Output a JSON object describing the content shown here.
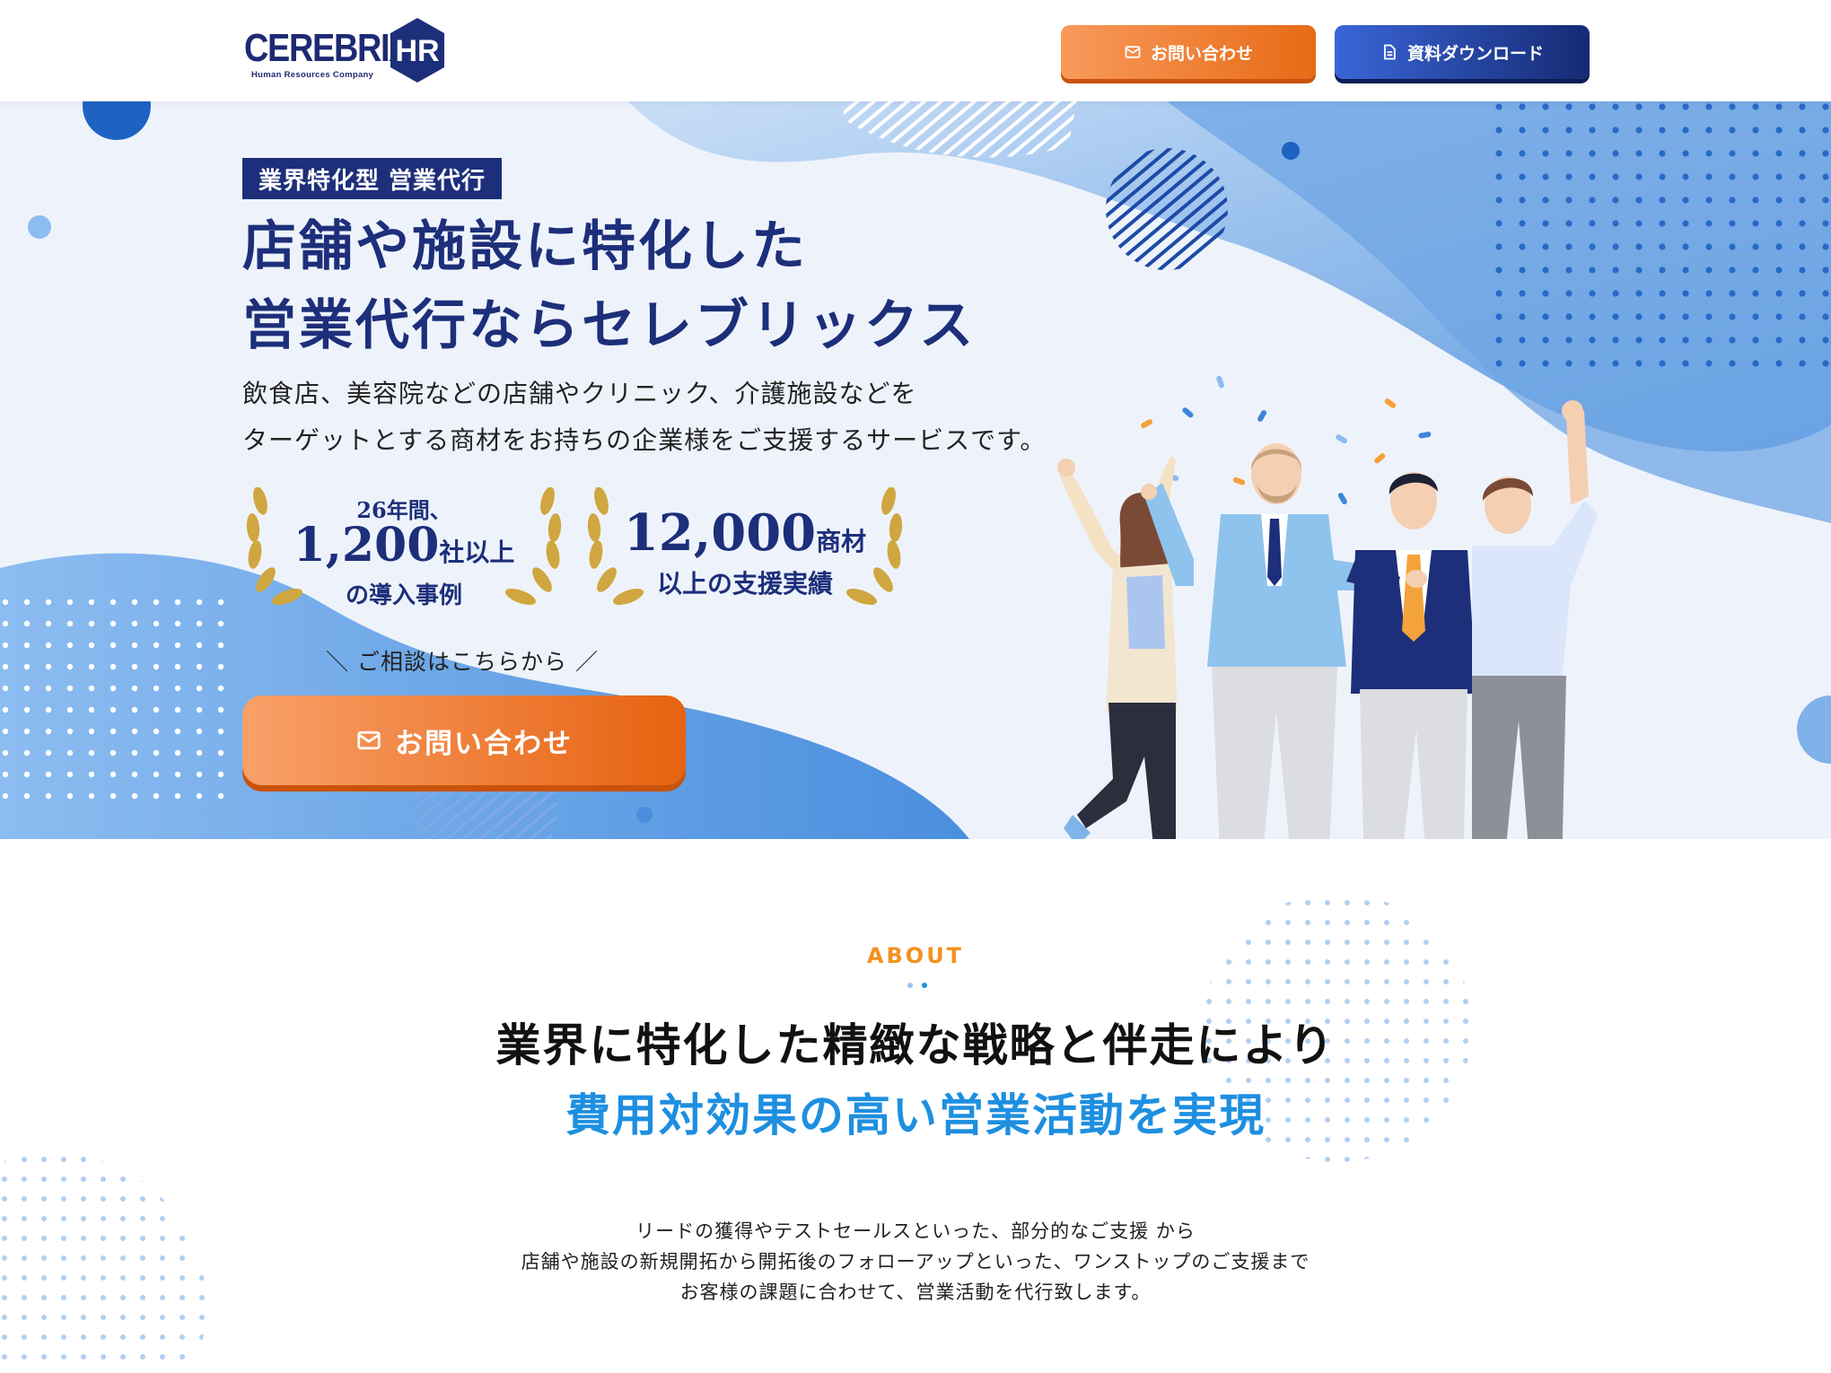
{
  "header": {
    "logo_text": "CEREBRIX",
    "logo_mark": "HR",
    "logo_sub": "Human Resources Company",
    "contact_label": "お問い合わせ",
    "contact_icon": "mail-icon",
    "download_label": "資料ダウンロード",
    "download_icon": "document-icon"
  },
  "hero": {
    "tag": "業界特化型 営業代行",
    "title_line1": "店舗や施設に特化した",
    "title_line2": "営業代行ならセレブリックス",
    "desc_line1": "飲食店、美容院などの店舗やクリニック、介護施設などを",
    "desc_line2": "ターゲットとする商材をお持ちの企業様をご支援するサービスです。",
    "award1": {
      "line1": "26年間、",
      "big": "1,200",
      "suffix": "社以上",
      "line3": "の導入事例"
    },
    "award2": {
      "big": "12,000",
      "suffix": "商材",
      "line2": "以上の支援実績"
    },
    "consult_note": "＼ ご相談はこちらから ／",
    "cta_label": "お問い合わせ",
    "cta_icon": "mail-icon"
  },
  "about": {
    "label": "ABOUT",
    "heading_line1": "業界に特化した精緻な戦略と伴走により",
    "heading_line2": "費用対効果の高い営業活動を実現",
    "body_line1": "リードの獲得やテストセールスといった、部分的なご支援 から",
    "body_line2": "店舗や施設の新規開拓から開拓後のフォローアップといった、ワンストップのご支援まで",
    "body_line3": "お客様の課題に合わせて、営業活動を代行致します。"
  },
  "colors": {
    "brand_navy": "#1d2f7a",
    "accent_orange": "#e86a16",
    "accent_blue": "#1e8fe0",
    "about_label": "#f3911f"
  }
}
